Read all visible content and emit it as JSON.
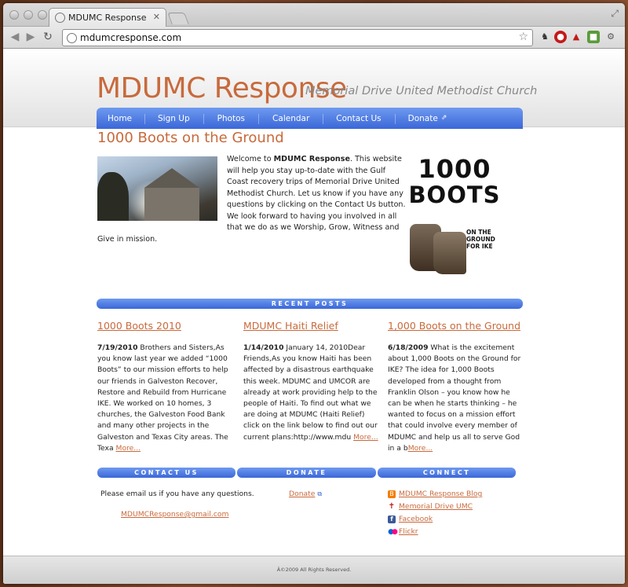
{
  "browser": {
    "tab_title": "MDUMC Response",
    "url": "mdumcresponse.com"
  },
  "site": {
    "title": "MDUMC Response",
    "subtitle": "Memorial Drive United Methodist Church",
    "nav": [
      "Home",
      "Sign Up",
      "Photos",
      "Calendar",
      "Contact Us",
      "Donate"
    ]
  },
  "main": {
    "page_title": "1000 Boots on the Ground",
    "welcome_pre": "Welcome to ",
    "welcome_bold": "MDUMC Response",
    "welcome_post": ". This website will help you stay up-to-date with the Gulf Coast recovery trips of Memorial Drive United Methodist Church. Let us know if you have any questions by clicking on the Contact Us button. We look forward to having you involved in all that we do as we Worship, Grow, Witness and Give in mission.",
    "boots_big_1": "1000",
    "boots_big_2": "BOOTS",
    "boots_ground": "ON THE GROUND FOR IKE"
  },
  "recent_posts": {
    "heading": "RECENT POSTS",
    "posts": [
      {
        "title": "1000 Boots 2010",
        "date": "7/19/2010",
        "body": " Brothers and Sisters,As you know last year we added “1000 Boots” to our mission efforts to help our friends in Galveston Recover, Restore and Rebuild from Hurricane IKE. We worked on 10 homes, 3 churches, the Galveston Food Bank and many other projects in the Galveston and Texas City areas. The Texa ",
        "more": "More..."
      },
      {
        "title": "MDUMC Haiti Relief",
        "date": "1/14/2010",
        "body": " January 14, 2010Dear Friends,As you know Haiti has been affected by a disastrous earthquake this week. MDUMC and UMCOR are already at work providing help to the people of Haiti. To find out what we are doing at MDUMC (Haiti Relief) click on the link below to find out our current plans:http://www.mdu ",
        "more": "More..."
      },
      {
        "title": "1,000 Boots on the Ground",
        "date": "6/18/2009",
        "body": " What is the excitement about 1,000 Boots on the Ground for IKE? The idea for 1,000 Boots developed from a thought from Franklin Olson – you know how he can be when he starts thinking – he wanted to focus on a mission effort that could involve every member of MDUMC and help us all to serve God in a b",
        "more": "More..."
      }
    ]
  },
  "bottom": {
    "contact_heading": "CONTACT US",
    "donate_heading": "DONATE",
    "connect_heading": "CONNECT",
    "contact_text": "Please email us if you have any questions.",
    "contact_email": "MDUMCResponse@gmail.com",
    "donate_link": "Donate",
    "connect_links": [
      "MDUMC Response Blog",
      "Memorial Drive UMC",
      "Facebook",
      "Flickr"
    ]
  },
  "footer": {
    "copyright": "Â©2009 All Rights Reserved."
  },
  "colors": {
    "accent": "#c86a3c",
    "nav_blue": "#3b67d8"
  }
}
